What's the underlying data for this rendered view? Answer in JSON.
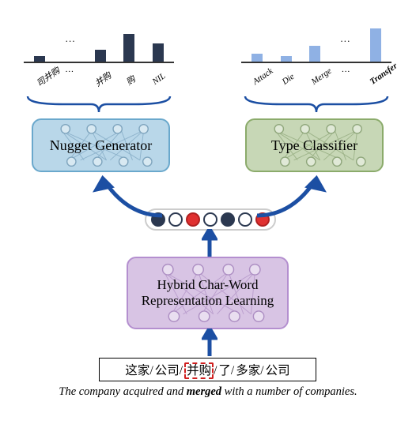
{
  "chart_data": [
    {
      "type": "bar",
      "title": "Nugget Generator output distribution",
      "categories": [
        "司并购",
        "…",
        "并购",
        "购",
        "NIL"
      ],
      "values": [
        12,
        null,
        26,
        60,
        40
      ],
      "color": "#2b3850",
      "ylim": [
        0,
        65
      ]
    },
    {
      "type": "bar",
      "title": "Type Classifier output distribution",
      "categories": [
        "Attack",
        "Die",
        "Merge",
        "…",
        "Transfer"
      ],
      "values": [
        18,
        12,
        34,
        null,
        72
      ],
      "color": "#8fb1e4",
      "ylim": [
        0,
        75
      ],
      "bold_category": "Transfer"
    }
  ],
  "modules": {
    "nugget": "Nugget Generator",
    "typecls": "Type Classifier",
    "hybrid_line1": "Hybrid Char-Word",
    "hybrid_line2": "Representation Learning"
  },
  "charts_left": {
    "ellipsis": "…",
    "labels": [
      "司并购",
      "…",
      "并购",
      "购",
      "NIL"
    ]
  },
  "charts_right": {
    "ellipsis": "…",
    "labels": [
      "Attack",
      "Die",
      "Merge",
      "…",
      "Transfer"
    ]
  },
  "vector_pattern": [
    "navy",
    "open",
    "red",
    "open",
    "navy",
    "open",
    "red"
  ],
  "input": {
    "tokens": [
      "这家",
      "公司",
      "并购",
      "了",
      "多家",
      "公司"
    ],
    "highlight_index": 2
  },
  "caption_pre": "The company acquired and ",
  "caption_bold": "merged",
  "caption_post": " with a number of companies.",
  "figure_line": ""
}
